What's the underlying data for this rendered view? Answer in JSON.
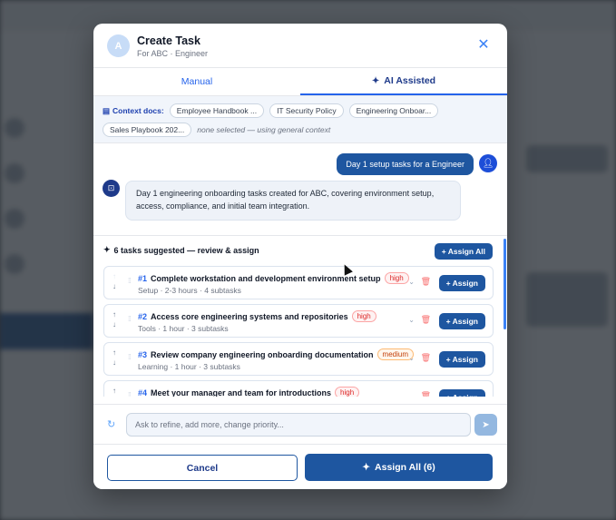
{
  "modal": {
    "avatar_letter": "A",
    "title": "Create Task",
    "subtitle": "For ABC · Engineer",
    "close_glyph": "✕"
  },
  "tabs": [
    {
      "label": "Manual",
      "active": false
    },
    {
      "label": "AI Assisted",
      "active": true
    }
  ],
  "context": {
    "label": "Context docs:",
    "docs": [
      "Employee Handbook ...",
      "IT Security Policy",
      "Engineering Onboar...",
      "Sales Playbook 202..."
    ],
    "note": "none selected — using general context"
  },
  "chat": {
    "user_message": "Day 1 setup tasks for a Engineer",
    "bot_message": "Day 1 engineering onboarding tasks created for ABC, covering environment setup, access, compliance, and initial team integration."
  },
  "suggestions": {
    "header": "6 tasks suggested — review & assign",
    "assign_all_label": "+ Assign All",
    "assign_label": "+ Assign",
    "tasks": [
      {
        "num": "#1",
        "title": "Complete workstation and development environment setup",
        "priority": "high",
        "meta": "Setup · 2-3 hours · 4 subtasks"
      },
      {
        "num": "#2",
        "title": "Access core engineering systems and repositories",
        "priority": "high",
        "meta": "Tools · 1 hour · 3 subtasks"
      },
      {
        "num": "#3",
        "title": "Review company engineering onboarding documentation",
        "priority": "medium",
        "meta": "Learning · 1 hour · 3 subtasks"
      },
      {
        "num": "#4",
        "title": "Meet your manager and team for introductions",
        "priority": "high",
        "meta": ""
      }
    ]
  },
  "input": {
    "placeholder": "Ask to refine, add more, change priority..."
  },
  "footer": {
    "cancel_label": "Cancel",
    "assign_all_label": "Assign All (6)"
  },
  "colors": {
    "primary": "#1e56a0",
    "accent": "#2563eb",
    "high": "#dc2626",
    "medium": "#c2410c"
  }
}
